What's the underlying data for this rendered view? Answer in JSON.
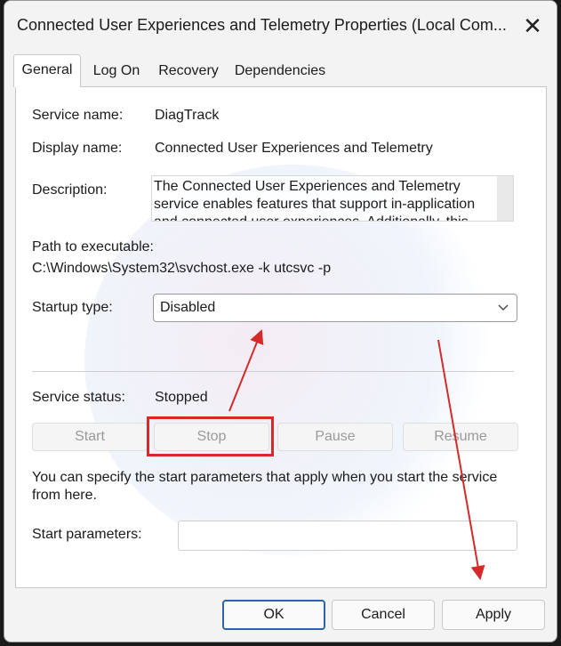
{
  "window": {
    "title": "Connected User Experiences and Telemetry Properties (Local Com...",
    "close_symbol": "✕"
  },
  "tabs": [
    {
      "label": "General",
      "active": true
    },
    {
      "label": "Log On",
      "active": false
    },
    {
      "label": "Recovery",
      "active": false
    },
    {
      "label": "Dependencies",
      "active": false
    }
  ],
  "general": {
    "service_name_label": "Service name:",
    "service_name_value": "DiagTrack",
    "display_name_label": "Display name:",
    "display_name_value": "Connected User Experiences and Telemetry",
    "description_label": "Description:",
    "description_text": "The Connected User Experiences and Telemetry service enables features that support in-application and connected user experiences. Additionally, this",
    "path_label": "Path to executable:",
    "path_value": "C:\\Windows\\System32\\svchost.exe -k utcsvc -p",
    "startup_type_label": "Startup type:",
    "startup_type_value": "Disabled",
    "service_status_label": "Service status:",
    "service_status_value": "Stopped",
    "buttons": {
      "start": "Start",
      "stop": "Stop",
      "pause": "Pause",
      "resume": "Resume"
    },
    "params_hint": "You can specify the start parameters that apply when you start the service from here.",
    "start_params_label": "Start parameters:",
    "start_params_value": ""
  },
  "footer": {
    "ok": "OK",
    "cancel": "Cancel",
    "apply": "Apply"
  },
  "annotation_color": "#d42a2a",
  "icons": {
    "close": "close-icon",
    "chevron": "chevron-down-icon"
  }
}
